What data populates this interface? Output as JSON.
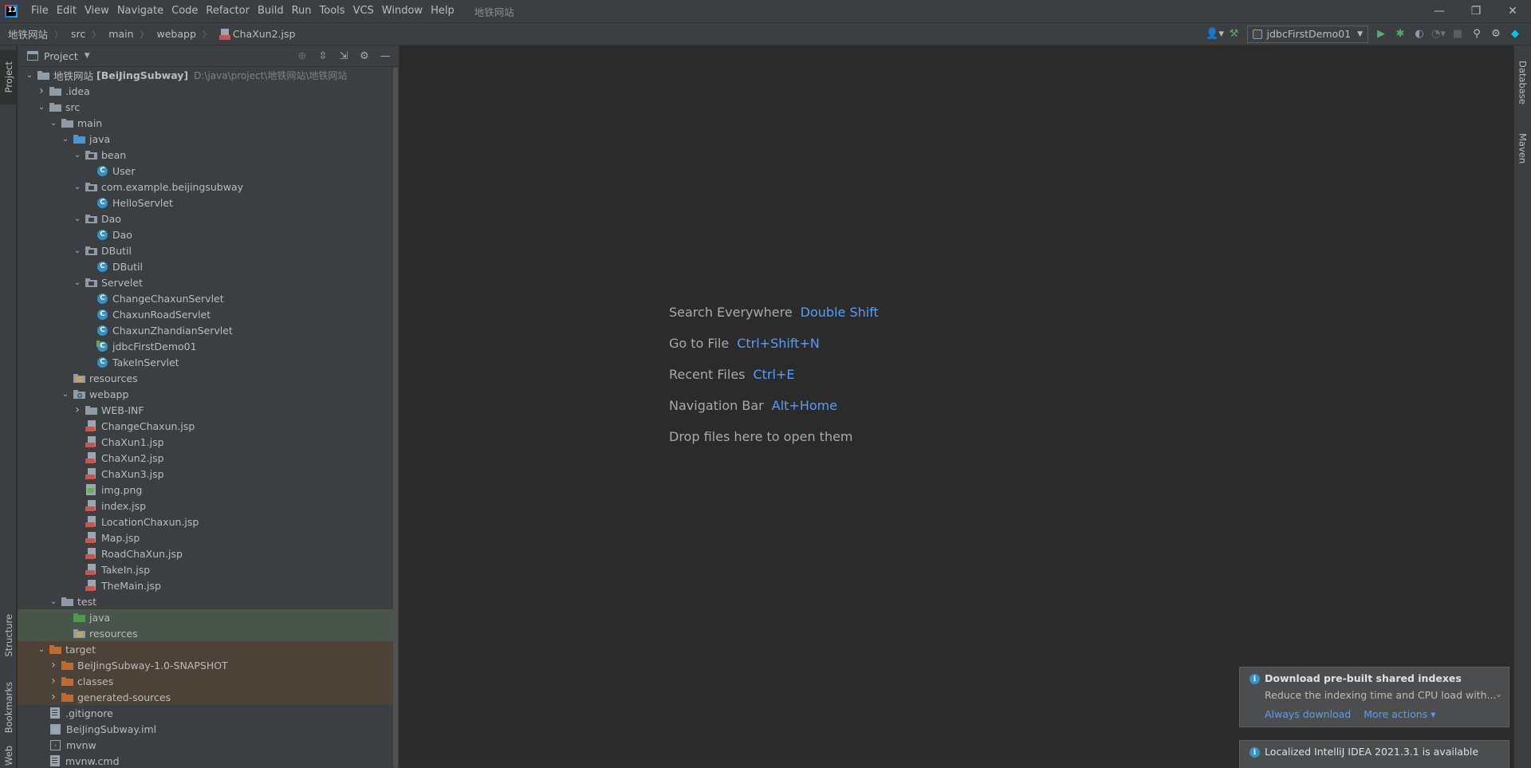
{
  "window": {
    "title": "地铁网站",
    "menu": [
      "File",
      "Edit",
      "View",
      "Navigate",
      "Code",
      "Refactor",
      "Build",
      "Run",
      "Tools",
      "VCS",
      "Window",
      "Help"
    ],
    "controls": {
      "minimize": "—",
      "restore": "❐",
      "close": "✕"
    }
  },
  "navbar": {
    "breadcrumbs": [
      "地铁网站",
      "src",
      "main",
      "webapp",
      "ChaXun2.jsp"
    ],
    "run_config": "jdbcFirstDemo01"
  },
  "left_stripe": {
    "tabs": [
      "Project",
      "Structure",
      "Bookmarks",
      "Web"
    ]
  },
  "right_stripe": {
    "tabs": [
      "Database",
      "Maven"
    ]
  },
  "project_panel": {
    "title": "Project",
    "tree": [
      {
        "depth": 0,
        "expanded": true,
        "icon": "module",
        "label": "地铁网站",
        "bold_suffix": "[BeiJingSubway]",
        "path": "D:\\java\\project\\地铁网站\\地铁网站"
      },
      {
        "depth": 1,
        "expanded": false,
        "icon": "folder-grey",
        "label": ".idea"
      },
      {
        "depth": 1,
        "expanded": true,
        "icon": "folder-grey",
        "label": "src"
      },
      {
        "depth": 2,
        "expanded": true,
        "icon": "folder-grey",
        "label": "main"
      },
      {
        "depth": 3,
        "expanded": true,
        "icon": "folder-blue",
        "label": "java"
      },
      {
        "depth": 4,
        "expanded": true,
        "icon": "package",
        "label": "bean"
      },
      {
        "depth": 5,
        "icon": "class",
        "label": "User"
      },
      {
        "depth": 4,
        "expanded": true,
        "icon": "package",
        "label": "com.example.beijingsubway"
      },
      {
        "depth": 5,
        "icon": "class",
        "label": "HelloServlet"
      },
      {
        "depth": 4,
        "expanded": true,
        "icon": "package",
        "label": "Dao"
      },
      {
        "depth": 5,
        "icon": "class",
        "label": "Dao"
      },
      {
        "depth": 4,
        "expanded": true,
        "icon": "package",
        "label": "DButil"
      },
      {
        "depth": 5,
        "icon": "class",
        "label": "DButil"
      },
      {
        "depth": 4,
        "expanded": true,
        "icon": "package",
        "label": "Servelet"
      },
      {
        "depth": 5,
        "icon": "class",
        "label": "ChangeChaxunServlet"
      },
      {
        "depth": 5,
        "icon": "class",
        "label": "ChaxunRoadServlet"
      },
      {
        "depth": 5,
        "icon": "class",
        "label": "ChaxunZhandianServlet"
      },
      {
        "depth": 5,
        "icon": "class-run",
        "label": "jdbcFirstDemo01"
      },
      {
        "depth": 5,
        "icon": "class",
        "label": "TakeInServlet"
      },
      {
        "depth": 3,
        "icon": "folder-resources",
        "label": "resources"
      },
      {
        "depth": 3,
        "expanded": true,
        "icon": "folder-web",
        "label": "webapp"
      },
      {
        "depth": 4,
        "expanded": false,
        "icon": "folder-grey",
        "label": "WEB-INF"
      },
      {
        "depth": 4,
        "icon": "jsp",
        "label": "ChangeChaxun.jsp"
      },
      {
        "depth": 4,
        "icon": "jsp",
        "label": "ChaXun1.jsp"
      },
      {
        "depth": 4,
        "icon": "jsp",
        "label": "ChaXun2.jsp"
      },
      {
        "depth": 4,
        "icon": "jsp",
        "label": "ChaXun3.jsp"
      },
      {
        "depth": 4,
        "icon": "image",
        "label": "img.png"
      },
      {
        "depth": 4,
        "icon": "jsp",
        "label": "index.jsp"
      },
      {
        "depth": 4,
        "icon": "jsp",
        "label": "LocationChaxun.jsp"
      },
      {
        "depth": 4,
        "icon": "jsp",
        "label": "Map.jsp"
      },
      {
        "depth": 4,
        "icon": "jsp",
        "label": "RoadChaXun.jsp"
      },
      {
        "depth": 4,
        "icon": "jsp",
        "label": "TakeIn.jsp"
      },
      {
        "depth": 4,
        "icon": "jsp",
        "label": "TheMain.jsp"
      },
      {
        "depth": 2,
        "expanded": true,
        "icon": "folder-grey",
        "label": "test"
      },
      {
        "depth": 3,
        "icon": "folder-green",
        "label": "java",
        "highlight": "test"
      },
      {
        "depth": 3,
        "icon": "folder-resources",
        "label": "resources",
        "highlight": "test"
      },
      {
        "depth": 1,
        "expanded": true,
        "icon": "folder-orange",
        "label": "target",
        "highlight": "excluded"
      },
      {
        "depth": 2,
        "expanded": false,
        "icon": "folder-orange",
        "label": "BeiJingSubway-1.0-SNAPSHOT",
        "highlight": "excluded"
      },
      {
        "depth": 2,
        "expanded": false,
        "icon": "folder-orange",
        "label": "classes",
        "highlight": "excluded"
      },
      {
        "depth": 2,
        "expanded": false,
        "icon": "folder-orange",
        "label": "generated-sources",
        "highlight": "excluded"
      },
      {
        "depth": 1,
        "icon": "file-gitignore",
        "label": ".gitignore"
      },
      {
        "depth": 1,
        "icon": "file-iml",
        "label": "BeiJingSubway.iml"
      },
      {
        "depth": 1,
        "icon": "file-cmd",
        "label": "mvnw"
      },
      {
        "depth": 1,
        "icon": "file-generic",
        "label": "mvnw.cmd"
      }
    ]
  },
  "editor": {
    "hints": [
      {
        "label": "Search Everywhere",
        "key": "Double Shift"
      },
      {
        "label": "Go to File",
        "key": "Ctrl+Shift+N"
      },
      {
        "label": "Recent Files",
        "key": "Ctrl+E"
      },
      {
        "label": "Navigation Bar",
        "key": "Alt+Home"
      },
      {
        "label": "Drop files here to open them",
        "key": ""
      }
    ]
  },
  "notifications": [
    {
      "title": "Download pre-built shared indexes",
      "body": "Reduce the indexing time and CPU load with...",
      "actions": [
        "Always download",
        "More actions ▾"
      ]
    },
    {
      "title": "Localized IntelliJ IDEA 2021.3.1 is available",
      "body": "",
      "actions": []
    }
  ]
}
